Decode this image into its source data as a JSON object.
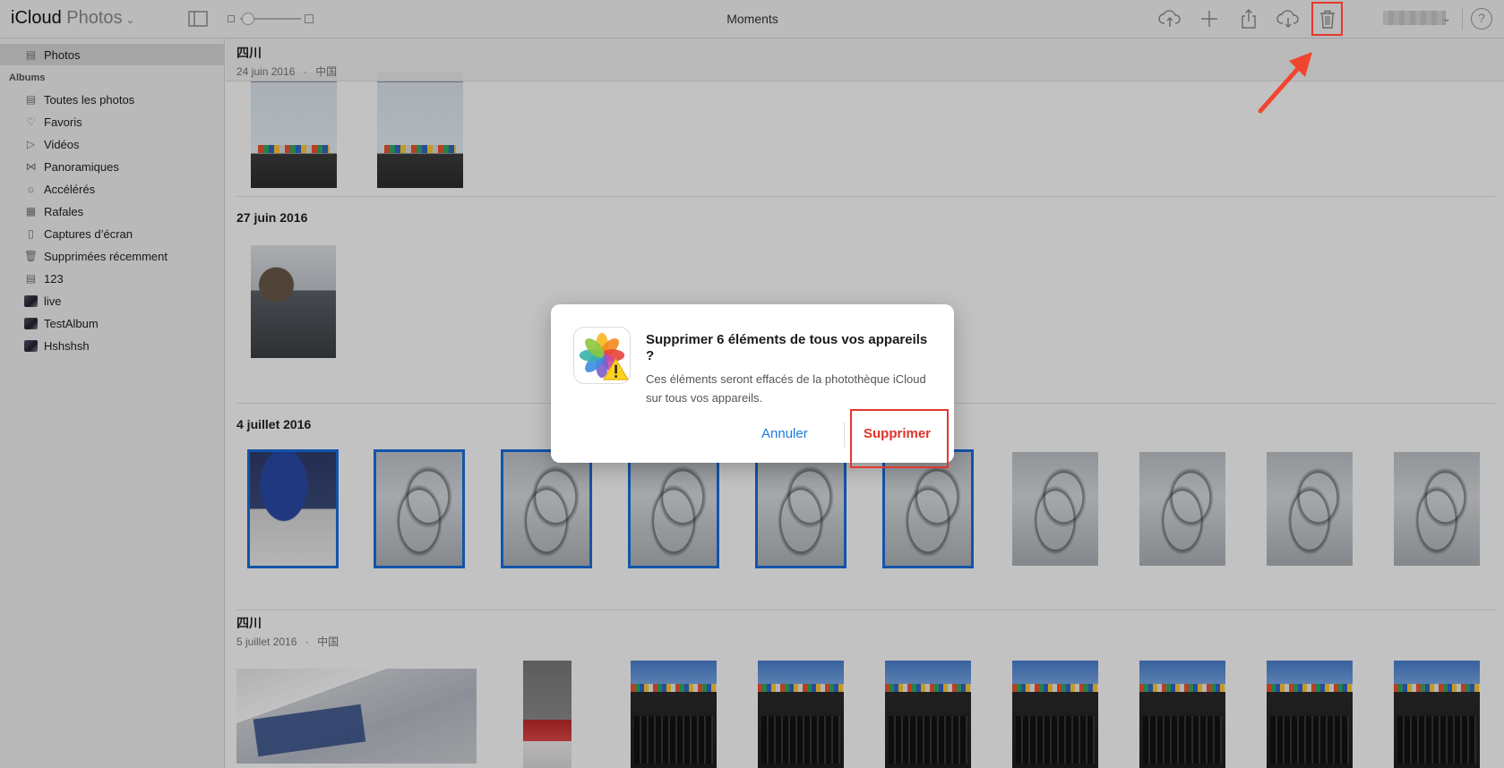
{
  "toolbar": {
    "brand_main": "iCloud",
    "brand_app": "Photos",
    "title": "Moments",
    "help": "?"
  },
  "sidebar": {
    "photos_label": "Photos",
    "albums_heading": "Albums",
    "items": [
      {
        "label": "Toutes les photos",
        "icon": "photos-stack-icon"
      },
      {
        "label": "Favoris",
        "icon": "heart-icon"
      },
      {
        "label": "Vidéos",
        "icon": "video-icon"
      },
      {
        "label": "Panoramiques",
        "icon": "panorama-icon"
      },
      {
        "label": "Accélérés",
        "icon": "timelapse-icon"
      },
      {
        "label": "Rafales",
        "icon": "burst-icon"
      },
      {
        "label": "Captures d’écran",
        "icon": "screenshot-icon"
      },
      {
        "label": "Supprimées récemment",
        "icon": "trash-icon"
      },
      {
        "label": "123",
        "icon": "album-icon"
      },
      {
        "label": "live",
        "icon": "album-thumb-icon"
      },
      {
        "label": "TestAlbum",
        "icon": "album-thumb-icon"
      },
      {
        "label": "Hshshsh",
        "icon": "album-thumb-icon"
      }
    ]
  },
  "sections": [
    {
      "title": "四川",
      "date": "24 juin 2016",
      "sep": "·",
      "place": "中国"
    },
    {
      "title": "27 juin 2016"
    },
    {
      "title": "4 juillet 2016"
    },
    {
      "title": "四川",
      "date": "5 juillet 2016",
      "sep": "·",
      "place": "中国"
    }
  ],
  "dialog": {
    "title": "Supprimer 6 éléments de tous vos appareils ?",
    "body": "Ces éléments seront effacés de la photothèque iCloud sur tous vos appareils.",
    "cancel": "Annuler",
    "delete": "Supprimer"
  },
  "colors": {
    "accent": "#1a7be0",
    "danger": "#e0322a",
    "selection": "#1a6fe0",
    "annotation": "#e3382d"
  }
}
